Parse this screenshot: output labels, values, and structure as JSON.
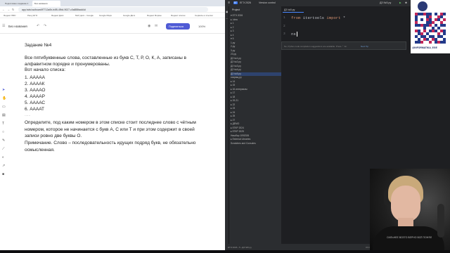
{
  "browser": {
    "tabs": [
      "Подготовка к заданию 1",
      "Без названия"
    ],
    "url": "app.holst.so/board/f7712a0b-b4f5-49b4-9027-c0a855fadd4d",
    "bookmarks": [
      "Яндекс ЛМС",
      "Решу ЕГЭ",
      "Яндекс Диск",
      "Мой диск – Google",
      "Google Маps",
      "Google Диск",
      "Яндекс Формы",
      "Яндекс плагин",
      "Сервисы и ссылки"
    ],
    "board_title": "Без названия",
    "share_label": "Поделиться",
    "zoom": "100%"
  },
  "task": {
    "title": "Задание №4",
    "intro": "Все пятибуквенные слова, составленные из букв С, Т, Р, О, К, А, записаны в алфавитном порядке и пронумерованы.",
    "start_label": "Вот начало списка:",
    "items": [
      "1.  ААААА",
      "2.  ААААК",
      "3.  ААААО",
      "4.  ААААР",
      "5.  ААААС",
      "6.  ААААТ"
    ],
    "divider": "......",
    "question": "Определите, под каким номером в этом списке стоит последнее слово с чётным номером, которое не начинается с букв А, С или Т и при этом содержит в своей записи ровно две буквы О.",
    "note": "Примечание. Слово – последовательность идущих подряд букв, не обязательно осмысленная."
  },
  "ide": {
    "project": "ЕГЭ 2026",
    "vcs": "Version control",
    "file": "ДЗ №5.py",
    "panel_title": "Project",
    "tree": [
      "▾ ЕГЭ 2026",
      "  ▸ .idea",
      "  ▸ 1",
      "  ▸ 2",
      "  ▸ 3",
      "  ▸ 4",
      "  ▾ 5",
      "     1.py",
      "     2.py",
      "     3.py",
      "     23.py",
      "     ДЗ №1.py",
      "     ДЗ №2.py",
      "     ДЗ №3.py",
      "     ДЗ №4.py",
      "     ДЗ №5.py",
      "     сокращ.py",
      "  ▸ 14",
      "  ▸ 15",
      "  ▸ 16 интервалы",
      "  ▸ 17",
      "  ▸ 18",
      "  ▸ 19-21",
      "  ▸ 22",
      "  ▸ 23",
      "  ▸ 24",
      "  ▸ 25",
      "  ▸ 27",
      "  ▸ ДЕМО",
      "  ▸ ЕГКР 2024",
      "  ▸ ЕГКР 2025",
      "     Нашбор 1092026",
      "▸ External Libraries",
      "  Scratches and Consoles"
    ],
    "code_lines": [
      {
        "num": "1",
        "kw": "from",
        "rest": " itertools ",
        "kw2": "import",
        "rest2": " *"
      },
      {
        "num": "2",
        "kw": "",
        "rest": "",
        "kw2": "",
        "rest2": ""
      },
      {
        "num": "3",
        "kw": "",
        "rest": "ns",
        "kw2": "",
        "rest2": ""
      }
    ],
    "popup_text": "No, Python code completion suggestions are available. Press ⌃ for",
    "popup_link": "Next Tip",
    "status_left": "ЕГЭ 2026 › 5 › ДЗ №5.py",
    "status_right": "3:3   CRLF   UTF-8   4 spaces   Python 3.12"
  },
  "logo": {
    "text": "@INFORMATIKA_EGE"
  },
  "webcam": {
    "shirt_text": "СИЛЬНЕЕ ВСЕГО ВЕРНО ВСЁ ПОНЯЛ"
  },
  "colors": {
    "accent": "#4f5bd5",
    "ide_bg": "#1e1f22",
    "keyword": "#cf8e6d"
  }
}
